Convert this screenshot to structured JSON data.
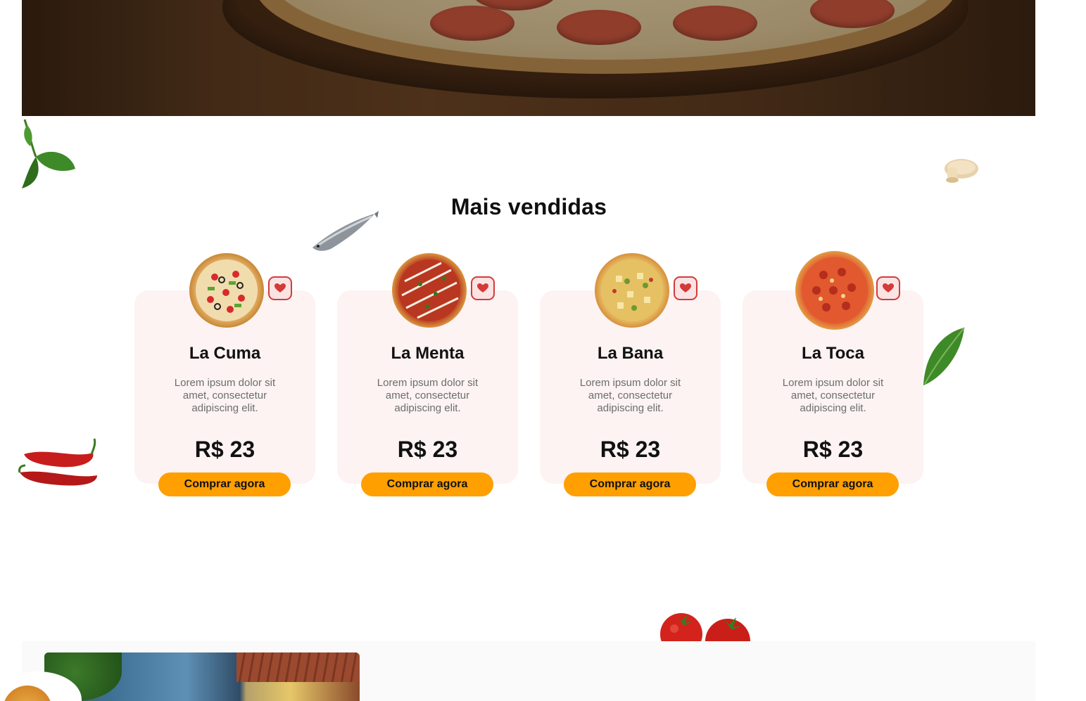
{
  "section": {
    "title": "Mais vendidas"
  },
  "products": [
    {
      "name": "La Cuma",
      "description": "Lorem ipsum dolor sit amet, consectetur adipiscing elit.",
      "price": "R$ 23",
      "buy_label": "Comprar agora",
      "favorite_icon": "heart-icon"
    },
    {
      "name": "La Menta",
      "description": "Lorem ipsum dolor sit amet, consectetur adipiscing elit.",
      "price": "R$ 23",
      "buy_label": "Comprar agora",
      "favorite_icon": "heart-icon"
    },
    {
      "name": "La Bana",
      "description": "Lorem ipsum dolor sit amet, consectetur adipiscing elit.",
      "price": "R$ 23",
      "buy_label": "Comprar agora",
      "favorite_icon": "heart-icon"
    },
    {
      "name": "La Toca",
      "description": "Lorem ipsum dolor sit amet, consectetur adipiscing elit.",
      "price": "R$ 23",
      "buy_label": "Comprar agora",
      "favorite_icon": "heart-icon"
    }
  ],
  "colors": {
    "accent": "#ff9f00",
    "card_background": "#fcf3f2",
    "favorite": "#d33b3b"
  }
}
